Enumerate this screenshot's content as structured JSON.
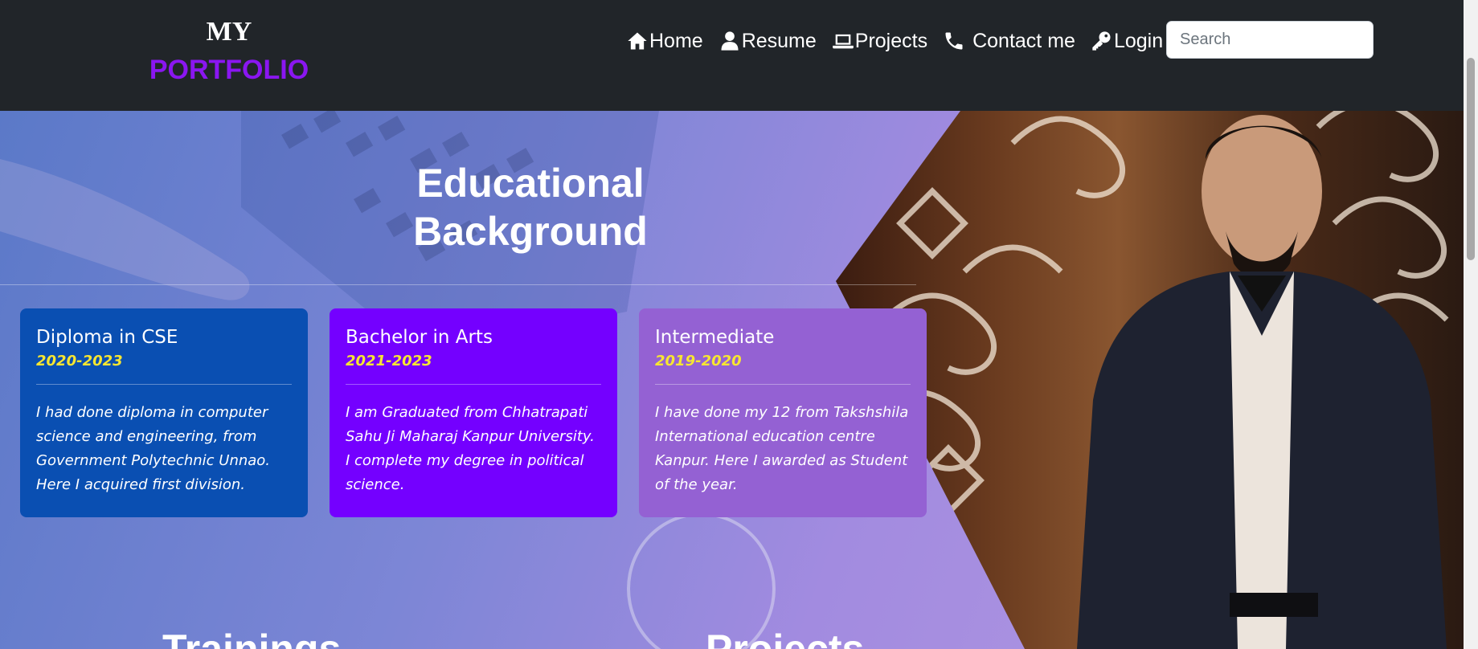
{
  "brand": {
    "line1": "MY",
    "line2": "PORTFOLIO"
  },
  "nav": {
    "items": [
      {
        "label": "Home",
        "icon": "home-icon"
      },
      {
        "label": "Resume",
        "icon": "user-icon"
      },
      {
        "label": "Projects",
        "icon": "laptop-icon"
      },
      {
        "label": "Contact me",
        "icon": "phone-icon"
      },
      {
        "label": "Login",
        "icon": "key-icon"
      }
    ],
    "search_placeholder": "Search"
  },
  "hero": {
    "title": "Educational Background"
  },
  "education": [
    {
      "title": "Diploma in CSE",
      "years": "2020-2023",
      "text": "I had done diploma in computer science and engineering, from Government Polytechnic Unnao. Here I acquired first division.",
      "color": "#0a4fb2"
    },
    {
      "title": "Bachelor in Arts",
      "years": "2021-2023",
      "text": "I am Graduated from Chhatrapati Sahu Ji Maharaj Kanpur University. I complete my degree in political science.",
      "color": "#7400ff"
    },
    {
      "title": "Intermediate",
      "years": "2019-2020",
      "text": "I have done my 12 from Takshshila International education centre Kanpur. Here I awarded as Student of the year.",
      "color": "#9461d3"
    }
  ],
  "sections": {
    "trainings": "Trainings",
    "projects": "Projects"
  },
  "colors": {
    "navbar": "#212529",
    "brand_accent": "#8a16f0",
    "year_highlight": "#f7e631"
  }
}
